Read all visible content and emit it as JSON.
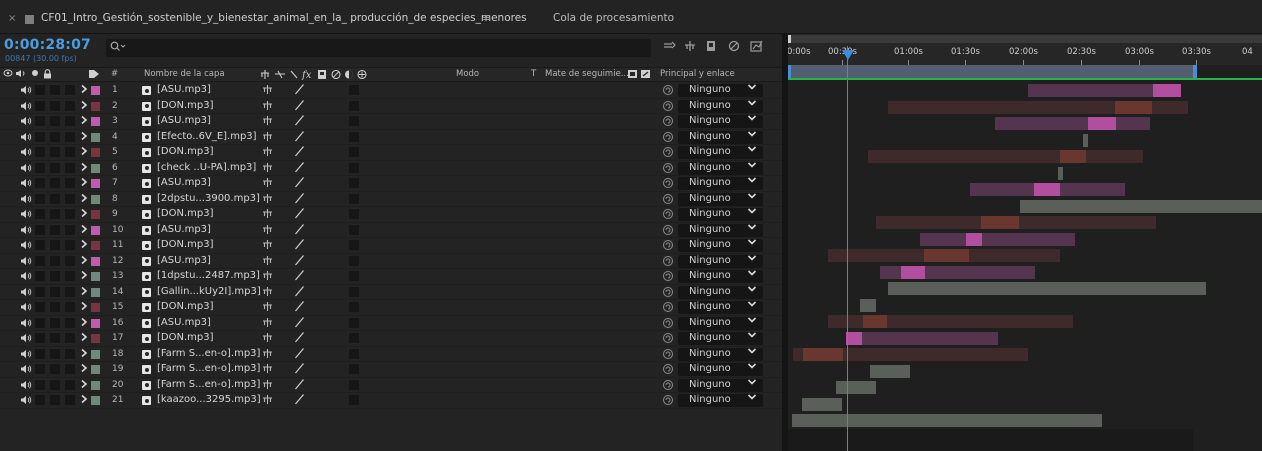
{
  "tabs": {
    "close": "×",
    "composition_title": "CF01_Intro_Gestión_sostenible_y_bienestar_animal_en_la_ producción_de especies_menores",
    "menu": "≡",
    "queue": "Cola de procesamiento"
  },
  "timecode": "0:00:28:07",
  "frames": "00847 (30.00 fps)",
  "search": {
    "placeholder": ""
  },
  "columns": {
    "layer_name": "Nombre de la capa",
    "mode": "Modo",
    "t": "T",
    "track_matte": "Mate de seguimie...",
    "parent": "Principal y enlace",
    "number_mark": "#"
  },
  "layers": [
    {
      "num": "1",
      "name": "[ASU.mp3]",
      "label": "#c25ab2",
      "parent": "Ninguno"
    },
    {
      "num": "2",
      "name": "[DON.mp3]",
      "label": "#7a3340",
      "parent": "Ninguno"
    },
    {
      "num": "3",
      "name": "[ASU.mp3]",
      "label": "#c25ab2",
      "parent": "Ninguno"
    },
    {
      "num": "4",
      "name": "[Efecto..6V_E].mp3]",
      "label": "#6f8a78",
      "parent": "Ninguno"
    },
    {
      "num": "5",
      "name": "[DON.mp3]",
      "label": "#7a3340",
      "parent": "Ninguno"
    },
    {
      "num": "6",
      "name": "[check ..U-PA].mp3]",
      "label": "#6f8a78",
      "parent": "Ninguno"
    },
    {
      "num": "7",
      "name": "[ASU.mp3]",
      "label": "#c25ab2",
      "parent": "Ninguno"
    },
    {
      "num": "8",
      "name": "[2dpstu...3900.mp3]",
      "label": "#6f8a78",
      "parent": "Ninguno"
    },
    {
      "num": "9",
      "name": "[DON.mp3]",
      "label": "#7a3340",
      "parent": "Ninguno"
    },
    {
      "num": "10",
      "name": "[ASU.mp3]",
      "label": "#c25ab2",
      "parent": "Ninguno"
    },
    {
      "num": "11",
      "name": "[DON.mp3]",
      "label": "#7a3340",
      "parent": "Ninguno"
    },
    {
      "num": "12",
      "name": "[ASU.mp3]",
      "label": "#c25ab2",
      "parent": "Ninguno"
    },
    {
      "num": "13",
      "name": "[1dpstu...2487.mp3]",
      "label": "#6f8a78",
      "parent": "Ninguno"
    },
    {
      "num": "14",
      "name": "[Gallin...kUy2I].mp3]",
      "label": "#6f8a78",
      "parent": "Ninguno"
    },
    {
      "num": "15",
      "name": "[DON.mp3]",
      "label": "#7a3340",
      "parent": "Ninguno"
    },
    {
      "num": "16",
      "name": "[ASU.mp3]",
      "label": "#c25ab2",
      "parent": "Ninguno"
    },
    {
      "num": "17",
      "name": "[DON.mp3]",
      "label": "#7a3340",
      "parent": "Ninguno"
    },
    {
      "num": "18",
      "name": "[Farm S...en-o].mp3]",
      "label": "#6f8a78",
      "parent": "Ninguno"
    },
    {
      "num": "19",
      "name": "[Farm S...en-o].mp3]",
      "label": "#6f8a78",
      "parent": "Ninguno"
    },
    {
      "num": "20",
      "name": "[Farm S...en-o].mp3]",
      "label": "#6f8a78",
      "parent": "Ninguno"
    },
    {
      "num": "21",
      "name": "[kaazoo...3295.mp3]",
      "label": "#6f8a78",
      "parent": "Ninguno"
    }
  ],
  "ruler": {
    "labels": [
      "0:00s",
      "00:30s",
      "01:00s",
      "01:30s",
      "02:00s",
      "02:30s",
      "03:00s",
      "03:30s",
      "04"
    ]
  },
  "colors": {
    "timecode": "#4a9ddf",
    "pink_layer": "#c25ab2",
    "red_layer": "#7a3340",
    "green_layer": "#6f8a78",
    "playhead": "#3c8ce0",
    "work_area_line": "#29b34a"
  },
  "icons": {
    "search": "search-icon",
    "speaker": "speaker-icon",
    "expand": "chevron-right-icon",
    "file": "audio-file-icon",
    "shy": "shy-icon",
    "pickwhip": "pickwhip-icon",
    "dropdown": "chevron-down-icon"
  }
}
